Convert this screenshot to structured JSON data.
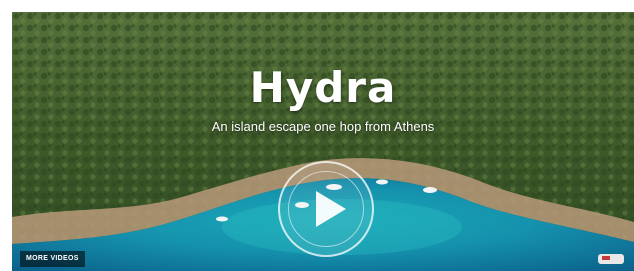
{
  "video": {
    "title": "Hydra",
    "subtitle": "An island escape one hop from Athens",
    "more_videos_label": "MORE VIDEOS",
    "play_icon": "play-icon"
  },
  "colors": {
    "sea_deep": "#0b5f8a",
    "sea_turquoise": "#1aa7b8",
    "hill_green": "#3f5a2a",
    "rock": "#b89a7a"
  }
}
